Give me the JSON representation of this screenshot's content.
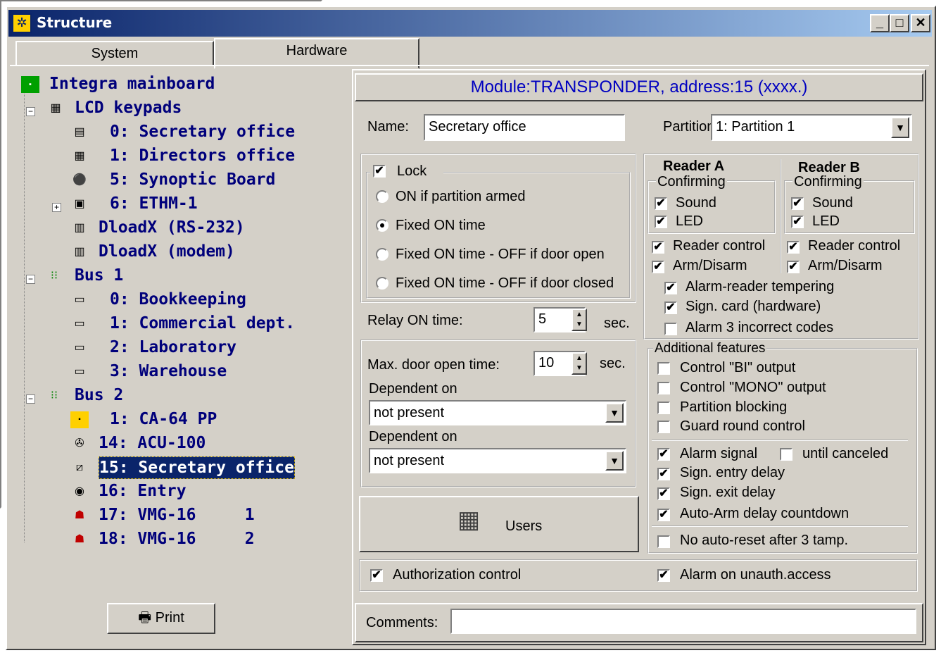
{
  "window": {
    "title": "Structure",
    "min": "_",
    "max": "□",
    "close": "✕"
  },
  "tabs": [
    {
      "label": "System"
    },
    {
      "label": "Hardware"
    }
  ],
  "tree": [
    {
      "label": "Integra mainboard"
    },
    {
      "label": "LCD keypads"
    },
    {
      "label": "0: Secretary office"
    },
    {
      "label": "1: Directors office"
    },
    {
      "label": "5: Synoptic Board"
    },
    {
      "label": "6: ETHM-1"
    },
    {
      "label": "DloadX (RS-232)"
    },
    {
      "label": "DloadX (modem)"
    },
    {
      "label": "Bus 1"
    },
    {
      "label": "0: Bookkeeping"
    },
    {
      "label": "1: Commercial dept."
    },
    {
      "label": "2: Laboratory"
    },
    {
      "label": "3: Warehouse"
    },
    {
      "label": "Bus 2"
    },
    {
      "label": "1: CA-64 PP"
    },
    {
      "label": "14: ACU-100"
    },
    {
      "label": "15: Secretary office"
    },
    {
      "label": "16: Entry"
    },
    {
      "label": "17: VMG-16     1"
    },
    {
      "label": "18: VMG-16     2"
    }
  ],
  "print_label": "Print",
  "module_header": "Module:TRANSPONDER, address:15 (xxxx.)",
  "name": {
    "label": "Name:",
    "value": "Secretary office"
  },
  "partition": {
    "label": "Partition",
    "value": "1: Partition  1"
  },
  "lock": {
    "label": "Lock",
    "checked": true
  },
  "lock_options": [
    {
      "label": "ON if partition armed",
      "selected": false
    },
    {
      "label": "Fixed ON time",
      "selected": true
    },
    {
      "label": "Fixed ON time - OFF if door open",
      "selected": false
    },
    {
      "label": "Fixed ON time - OFF if door closed",
      "selected": false
    }
  ],
  "relay": {
    "label": "Relay ON time:",
    "value": "5",
    "unit": "sec."
  },
  "door": {
    "label": "Max. door open time:",
    "value": "10",
    "unit": "sec."
  },
  "dependent": [
    {
      "label": "Dependent on",
      "value": "not present"
    },
    {
      "label": "Dependent on",
      "value": "not present"
    }
  ],
  "users_label": "Users",
  "readerA": {
    "title": "Reader A",
    "confirming": "Confirming",
    "sound": "Sound",
    "led": "LED",
    "reader_control": "Reader control",
    "arm": "Arm/Disarm"
  },
  "readerB": {
    "title": "Reader B",
    "confirming": "Confirming",
    "sound": "Sound",
    "led": "LED",
    "reader_control": "Reader control",
    "arm": "Arm/Disarm"
  },
  "reader_common": [
    {
      "label": "Alarm-reader tempering",
      "checked": true
    },
    {
      "label": "Sign. card (hardware)",
      "checked": true
    },
    {
      "label": "Alarm 3 incorrect codes",
      "checked": false
    }
  ],
  "additional": {
    "title": "Additional features",
    "items": [
      {
        "label": "Control \"BI\" output",
        "checked": false
      },
      {
        "label": "Control \"MONO\" output",
        "checked": false
      },
      {
        "label": "Partition blocking",
        "checked": false
      },
      {
        "label": "Guard round control",
        "checked": false
      }
    ],
    "alarm_signal": "Alarm signal",
    "until_canceled": "until canceled",
    "signals": [
      {
        "label": "Sign. entry delay",
        "checked": true
      },
      {
        "label": "Sign. exit delay",
        "checked": true
      },
      {
        "label": "Auto-Arm delay countdown",
        "checked": true
      }
    ],
    "no_reset": "No auto-reset after 3 tamp."
  },
  "authorization": "Authorization control",
  "alarm_unauth": "Alarm on unauth.access",
  "comments_label": "Comments:",
  "check_mark": "✔"
}
